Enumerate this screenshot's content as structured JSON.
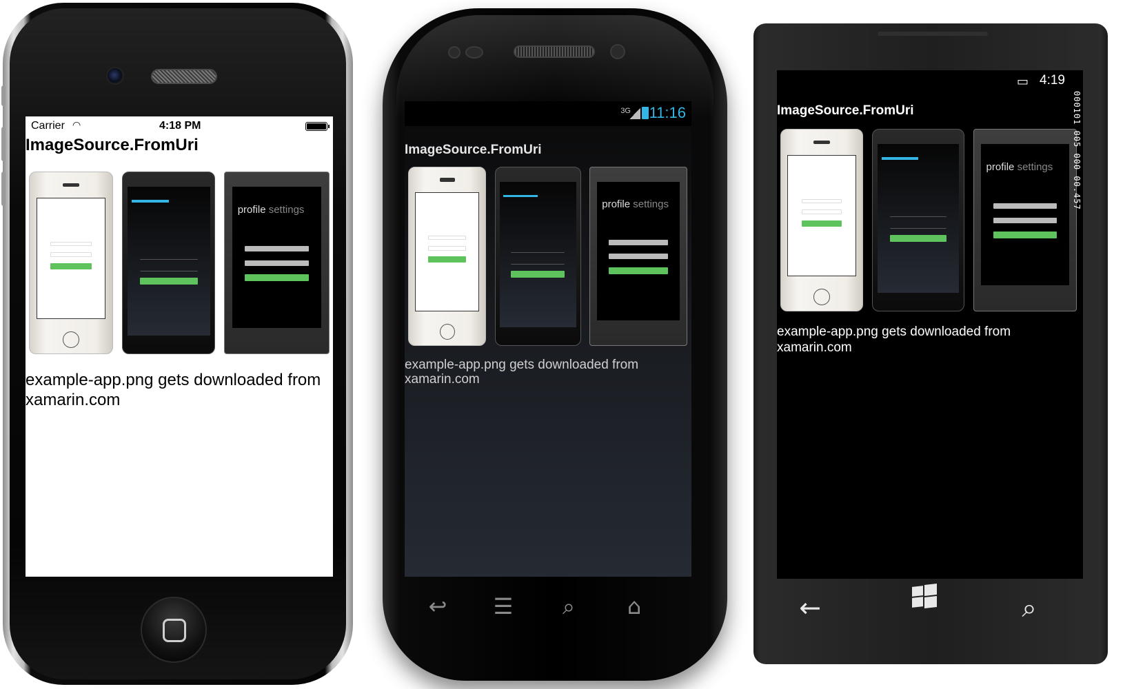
{
  "shared": {
    "page_title": "ImageSource.FromUri",
    "caption": "example-app.png gets downloaded from xamarin.com",
    "preview_mini_text": {
      "profile": "profile",
      "settings": "settings"
    }
  },
  "iphone": {
    "carrier": "Carrier",
    "time": "4:18 PM",
    "caption_line1": "example-app.png gets downloaded from",
    "caption_line2": "xamarin.com"
  },
  "android": {
    "network": "3G",
    "time": "11:16",
    "caption_line1": "example-app.png gets downloaded from",
    "caption_line2": "xamarin.com",
    "nav_icons": [
      "back-icon",
      "menu-icon",
      "search-icon",
      "home-icon"
    ]
  },
  "winphone": {
    "time": "4:19",
    "debug_counter": "000101 005 000 00.457",
    "nav_icons": [
      "back-icon",
      "windows-start-icon",
      "search-icon"
    ]
  },
  "colors": {
    "ios_bg": "#ffffff",
    "android_accent": "#33b5e5",
    "login_green": "#5ec25d",
    "wp_bg": "#000000"
  }
}
